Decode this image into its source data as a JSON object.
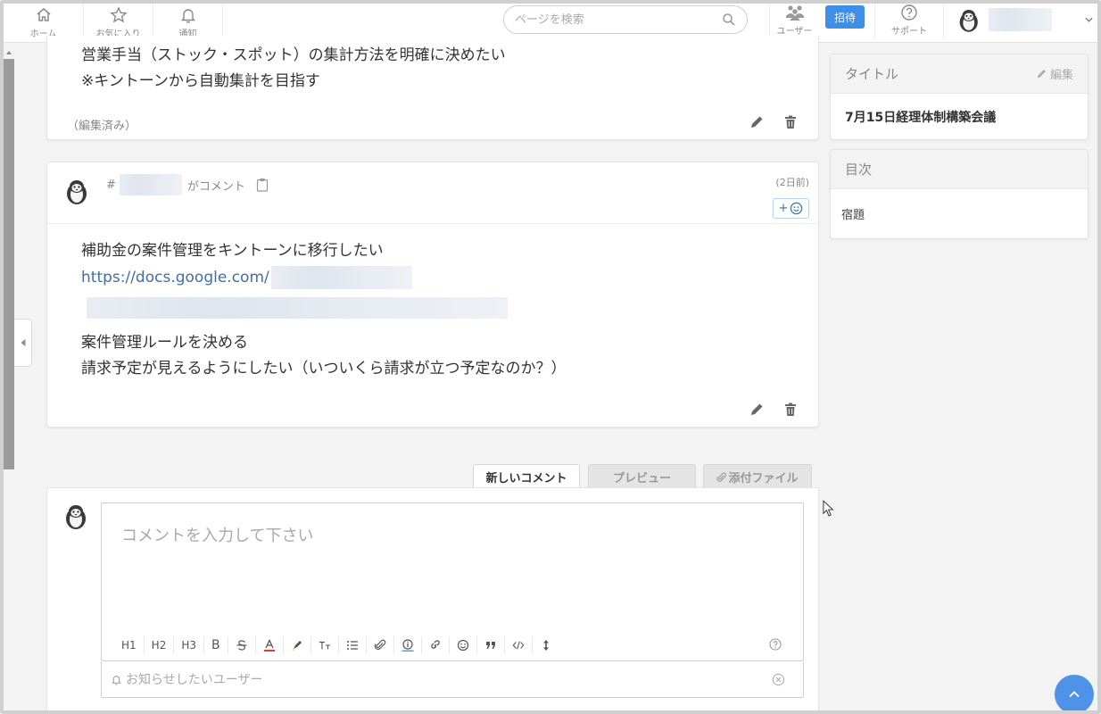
{
  "header": {
    "nav": [
      {
        "label": "ホーム",
        "icon": "home-icon"
      },
      {
        "label": "お気に入り",
        "icon": "star-icon"
      },
      {
        "label": "通知",
        "icon": "bell-icon"
      }
    ],
    "search_placeholder": "ページを検索",
    "users_label": "ユーザー",
    "invite_label": "招待",
    "support_label": "サポート"
  },
  "comment1": {
    "lines": [
      "営業手当（ストック・スポット）の集計方法を明確に決めたい",
      "※キントーンから自動集計を目指す"
    ],
    "edited_label": "（編集済み）"
  },
  "comment2": {
    "hash": "#",
    "commented_label": "がコメント",
    "time_label": "(2日前)",
    "reaction_label": "+",
    "line1": "補助金の案件管理をキントーンに移行したい",
    "link": "https://docs.google.com/",
    "line3": "案件管理ルールを決める",
    "line4": "請求予定が見えるようにしたい（いついくら請求が立つ予定なのか？）"
  },
  "sidebar": {
    "title_header": "タイトル",
    "edit_label": "編集",
    "title_value": "7月15日経理体制構築会議",
    "toc_header": "目次",
    "toc_items": [
      "宿題"
    ]
  },
  "tabs": {
    "new_comment": "新しいコメント",
    "preview": "プレビュー",
    "attach": "添付ファイル"
  },
  "editor": {
    "placeholder": "コメントを入力して下さい",
    "toolbar": [
      "H1",
      "H2",
      "H3",
      "B"
    ],
    "notify_placeholder": "お知らせしたいユーザー"
  },
  "colors": {
    "accent": "#3f8ee8",
    "link": "#3d6fa8",
    "scroll_top": "#4e93e8"
  }
}
